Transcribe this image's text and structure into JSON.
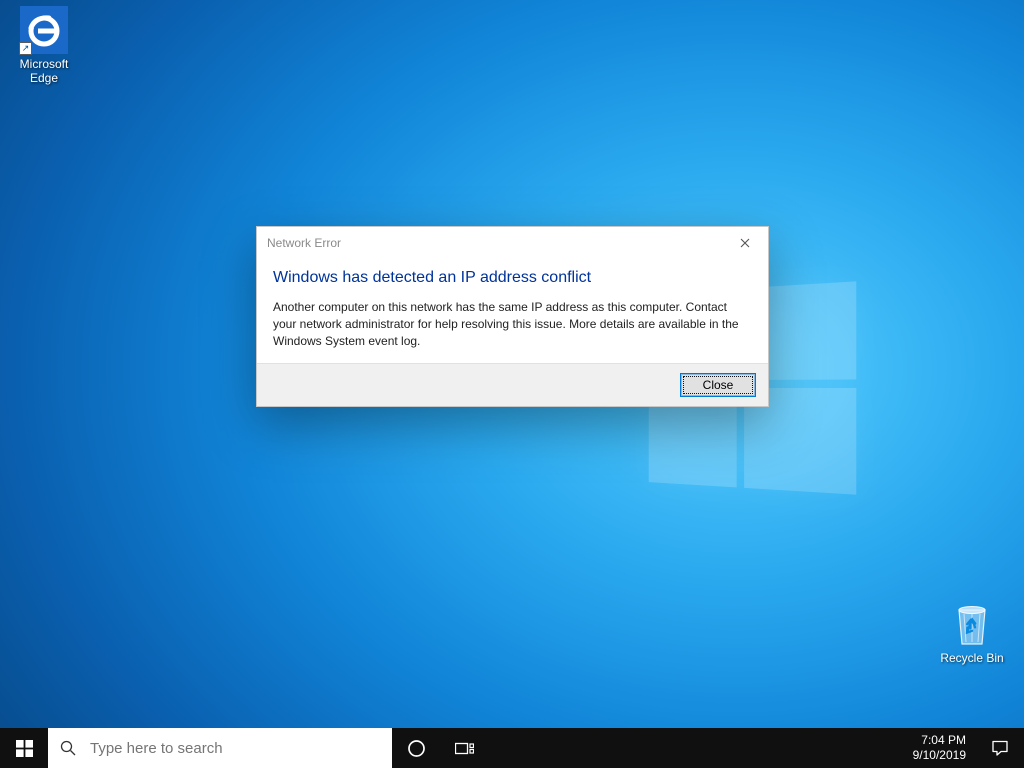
{
  "desktop": {
    "edge_label": "Microsoft Edge",
    "recycle_label": "Recycle Bin"
  },
  "dialog": {
    "title": "Network Error",
    "heading": "Windows has detected an IP address conflict",
    "body": "Another computer on this network has the same IP address as this computer. Contact your network administrator for help resolving this issue. More details are available in the Windows System event log.",
    "close_button": "Close"
  },
  "taskbar": {
    "search_placeholder": "Type here to search",
    "time": "7:04 PM",
    "date": "9/10/2019"
  }
}
